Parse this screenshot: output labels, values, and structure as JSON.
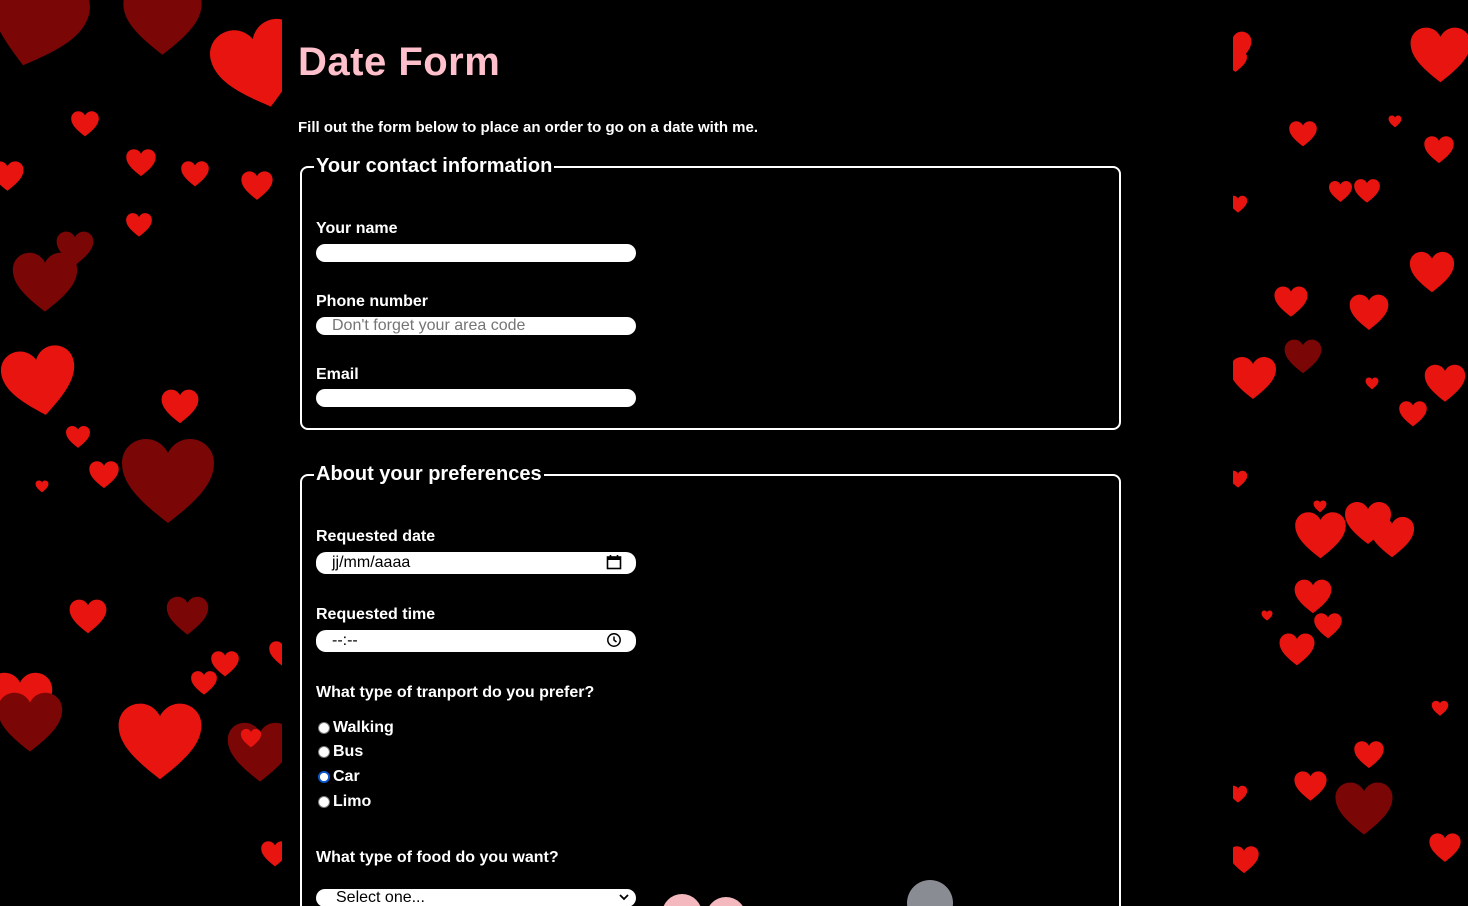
{
  "page": {
    "title": "Date Form",
    "intro": "Fill out the form below to place an order to go on a date with me."
  },
  "colors": {
    "background": "#000000",
    "title": "#ffc0cb",
    "heart_bright": "#e8140f",
    "heart_dark": "#7a0606",
    "radio_accent": "#0b57d0"
  },
  "contact": {
    "legend": "Your contact information",
    "name_label": "Your name",
    "name_value": "",
    "phone_label": "Phone number",
    "phone_placeholder": "Don't forget your area code",
    "email_label": "Email",
    "email_value": ""
  },
  "preferences": {
    "legend": "About your preferences",
    "date_label": "Requested date",
    "date_placeholder": "jj/mm/aaaa",
    "date_icon": "calendar-icon",
    "time_label": "Requested time",
    "time_placeholder": "--:--",
    "time_icon": "clock-icon",
    "transport_question": "What type of tranport do you prefer?",
    "transport_options": [
      {
        "label": "Walking",
        "checked": false
      },
      {
        "label": "Bus",
        "checked": false
      },
      {
        "label": "Car",
        "checked": true
      },
      {
        "label": "Limo",
        "checked": false
      }
    ],
    "food_question": "What type of food do you want?",
    "food_selected": "Select one..."
  }
}
